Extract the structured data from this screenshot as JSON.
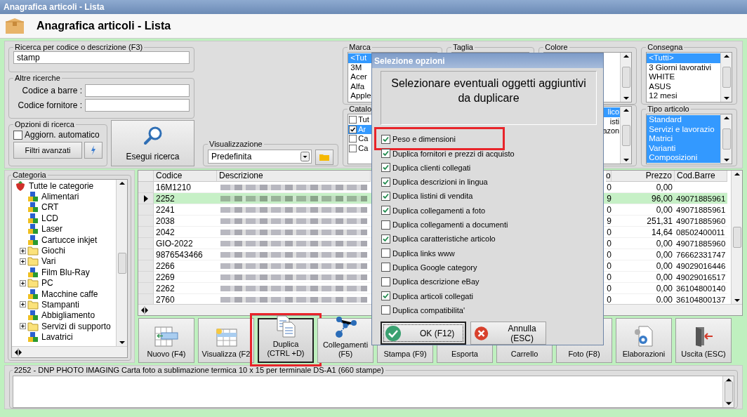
{
  "window": {
    "title": "Anagrafica articoli  - Lista"
  },
  "header": {
    "title": "Anagrafica articoli  - Lista"
  },
  "search": {
    "label": "Ricerca per codice o descrizione (F3)",
    "value": "stamp"
  },
  "other_searches": {
    "label": "Altre ricerche",
    "fields": [
      {
        "label": "Codice a barre :"
      },
      {
        "label": "Codice fornitore :"
      }
    ]
  },
  "search_options": {
    "label": "Opzioni di ricerca",
    "auto_update": {
      "label": "Aggiorn. automatico",
      "checked": false
    },
    "advanced_filters": "Filtri avanzati"
  },
  "run_search": "Esegui ricerca",
  "view": {
    "label": "Visualizzazione",
    "value": "Predefinita"
  },
  "filters_top": [
    {
      "label": "Marca",
      "kind": "list",
      "items": [
        {
          "label": "<Tut",
          "selected": true
        },
        {
          "label": "3M",
          "selected": false
        },
        {
          "label": "Acer",
          "selected": false
        },
        {
          "label": "Alfa",
          "selected": false
        },
        {
          "label": "Apple",
          "selected": false
        }
      ]
    },
    {
      "label": "Taglia",
      "kind": "list"
    },
    {
      "label": "Colore",
      "kind": "list"
    },
    {
      "label": "Consegna",
      "kind": "list",
      "items": [
        {
          "label": "<Tutti>",
          "selected": true
        },
        {
          "label": "3 Giorni lavorativi",
          "selected": false
        },
        {
          "label": "WHITE",
          "selected": false
        },
        {
          "label": "ASUS",
          "selected": false
        },
        {
          "label": "12 mesi",
          "selected": false
        }
      ]
    }
  ],
  "filters_bottom": [
    {
      "label": "Catalo",
      "kind": "checklist",
      "items": [
        {
          "label": "Tut",
          "checked": false,
          "selected": false
        },
        {
          "label": "Ar",
          "checked": true,
          "selected": true
        },
        {
          "label": "Ca",
          "checked": false,
          "selected": false
        },
        {
          "label": "Ca",
          "checked": false,
          "selected": false
        }
      ]
    },
    {
      "kind": "list_end",
      "items": [
        {
          "label": "lico",
          "selected": true
        },
        {
          "label": "isti",
          "selected": false
        },
        {
          "label": "azon",
          "selected": false
        }
      ]
    },
    {
      "label": "Tipo articolo",
      "kind": "list",
      "items": [
        {
          "label": "Standard",
          "selected": true
        },
        {
          "label": "Servizi e lavorazio",
          "selected": true
        },
        {
          "label": "Matrici",
          "selected": true
        },
        {
          "label": "Varianti",
          "selected": true
        },
        {
          "label": "Composizioni",
          "selected": true
        }
      ]
    }
  ],
  "category": {
    "label": "Categoria",
    "tree": [
      {
        "label": "Tutte le categorie",
        "kind": "root",
        "children": [
          {
            "label": "Alimentari",
            "kind": "group"
          },
          {
            "label": "CRT",
            "kind": "group"
          },
          {
            "label": "LCD",
            "kind": "group"
          },
          {
            "label": "Laser",
            "kind": "group"
          },
          {
            "label": "Cartucce inkjet",
            "kind": "group"
          },
          {
            "label": "Giochi",
            "kind": "folder",
            "expanded": false
          },
          {
            "label": "Vari",
            "kind": "folder",
            "expanded": false
          },
          {
            "label": "Film Blu-Ray",
            "kind": "group"
          },
          {
            "label": "PC",
            "kind": "folder",
            "expanded": false
          },
          {
            "label": "Macchine caffe",
            "kind": "group"
          },
          {
            "label": "Stampanti",
            "kind": "folder",
            "expanded": false
          },
          {
            "label": "Abbigliamento",
            "kind": "group"
          },
          {
            "label": "Servizi di supporto",
            "kind": "folder",
            "expanded": false
          },
          {
            "label": "Lavatrici",
            "kind": "group"
          }
        ]
      }
    ]
  },
  "table": {
    "columns": [
      "Codice",
      "Descrizione",
      "o",
      "Prezzo",
      "Cod.Barre"
    ],
    "rows": [
      {
        "codice": "16M1210",
        "column_3": "0",
        "prezzo": "0,00",
        "selected": false
      },
      {
        "codice": "2252",
        "column_3": "9",
        "prezzo": "96,00",
        "cod_barre": "49071885961",
        "selected": true
      },
      {
        "codice": "2241",
        "column_3": "0",
        "prezzo": "0,00",
        "cod_barre": "49071885961",
        "selected": false
      },
      {
        "codice": "2038",
        "column_3": "9",
        "prezzo": "251,31",
        "cod_barre": "49071885960",
        "selected": false
      },
      {
        "codice": "2042",
        "column_3": "0",
        "prezzo": "14,64",
        "cod_barre": "08502400011",
        "selected": false
      },
      {
        "codice": "GIO-2022",
        "column_3": "0",
        "prezzo": "0,00",
        "cod_barre": "49071885960",
        "selected": false
      },
      {
        "codice": "9876543466",
        "column_3": "0",
        "prezzo": "0,00",
        "cod_barre": "76662331747",
        "selected": false
      },
      {
        "codice": "2266",
        "column_3": "0",
        "prezzo": "0,00",
        "cod_barre": "49029016446",
        "selected": false
      },
      {
        "codice": "2269",
        "column_3": "0",
        "prezzo": "0,00",
        "cod_barre": "49029016517",
        "selected": false
      },
      {
        "codice": "2262",
        "column_3": "0",
        "prezzo": "0,00",
        "cod_barre": "36104800140",
        "selected": false
      },
      {
        "codice": "2760",
        "column_3": "0",
        "prezzo": "0.00",
        "cod_barre": "36104800137",
        "selected": false
      }
    ]
  },
  "toolbar": [
    {
      "label": "Nuovo (F4)",
      "focused": false,
      "highlighted": false
    },
    {
      "label": "Visualizza (F2",
      "focused": false,
      "highlighted": false
    },
    {
      "label": "Duplica\n(CTRL +D)",
      "focused": true,
      "highlighted": true
    },
    {
      "label": "Collegamenti\n(F5)",
      "focused": false,
      "highlighted": false
    },
    {
      "label": "Stampa (F9)",
      "focused": false,
      "highlighted": false
    },
    {
      "label": "Esporta",
      "focused": false,
      "highlighted": false
    },
    {
      "label": "Carrello",
      "focused": false,
      "highlighted": false
    },
    {
      "label": "Foto (F8)",
      "focused": false,
      "highlighted": false
    },
    {
      "label": "Elaborazioni",
      "focused": false,
      "highlighted": false
    },
    {
      "label": "Uscita (ESC)",
      "focused": false,
      "highlighted": false
    }
  ],
  "details": {
    "label": "2252 - DNP PHOTO IMAGING Carta foto a sublimazione termica 10 x 15 per terminale DS-A1 (660 stampe)"
  },
  "dialog": {
    "title": "Selezione opzioni",
    "message": "Selezionare eventuali oggetti aggiuntivi da duplicare",
    "options": [
      {
        "label": "Peso e dimensioni",
        "checked": true,
        "highlighted": true
      },
      {
        "label": "Duplica fornitori e prezzi di acquisto",
        "checked": true,
        "highlighted": false
      },
      {
        "label": "Duplica clienti collegati",
        "checked": true,
        "highlighted": false
      },
      {
        "label": "Duplica descrizioni in lingua",
        "checked": true,
        "highlighted": false
      },
      {
        "label": "Duplica listini di vendita",
        "checked": true,
        "highlighted": false
      },
      {
        "label": "Duplica collegamenti a foto",
        "checked": true,
        "highlighted": false
      },
      {
        "label": "Duplica collegamenti a documenti",
        "checked": false,
        "highlighted": false
      },
      {
        "label": "Duplica caratteristiche articolo",
        "checked": true,
        "highlighted": false
      },
      {
        "label": "Duplica links www",
        "checked": false,
        "highlighted": false
      },
      {
        "label": "Duplica Google category",
        "checked": false,
        "highlighted": false
      },
      {
        "label": "Duplica descrizione eBay",
        "checked": false,
        "highlighted": false
      },
      {
        "label": "Duplica articoli collegati",
        "checked": true,
        "highlighted": false
      },
      {
        "label": "Duplica compatibilita'",
        "checked": false,
        "highlighted": false
      }
    ],
    "buttons": [
      {
        "label": "OK (F12)",
        "focused": true
      },
      {
        "label": "Annulla (ESC)",
        "focused": false
      }
    ]
  }
}
